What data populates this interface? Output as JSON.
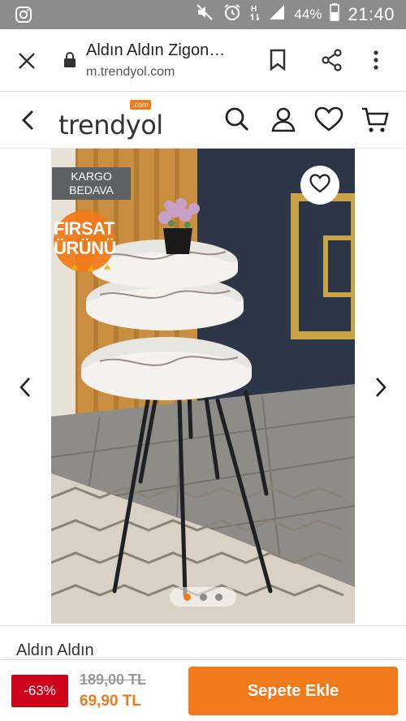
{
  "status_bar": {
    "battery_percent": "44%",
    "time": "21:40",
    "icons": [
      "instagram-icon",
      "mute-icon",
      "alarm-icon",
      "hspa-signal-icon",
      "cell-signal-icon",
      "battery-icon"
    ]
  },
  "browser": {
    "page_title": "Aldın Aldın Zigon…",
    "url": "m.trendyol.com",
    "icons": [
      "close-icon",
      "lock-icon",
      "bookmark-icon",
      "share-icon",
      "more-vert-icon"
    ]
  },
  "site_header": {
    "logo_text": "trendyol",
    "logo_badge": ".com",
    "icons": [
      "back-arrow-icon",
      "search-icon",
      "user-icon",
      "heart-icon",
      "cart-icon"
    ]
  },
  "gallery": {
    "kargo_badge_line1": "KARGO",
    "kargo_badge_line2": "BEDAVA",
    "firsat_line1": "FIRSAT",
    "firsat_line2": "ÜRÜNÜ",
    "dots_count": 3,
    "active_dot": 1
  },
  "product": {
    "name": "Aldın Aldın"
  },
  "bottom_bar": {
    "discount": "-63%",
    "old_price": "189,00 TL",
    "new_price": "69,90 TL",
    "add_to_cart": "Sepete Ekle"
  },
  "colors": {
    "brand_orange": "#f27a1a",
    "discount_red": "#d0021b",
    "status_bar_gray": "#8c8c8c"
  }
}
